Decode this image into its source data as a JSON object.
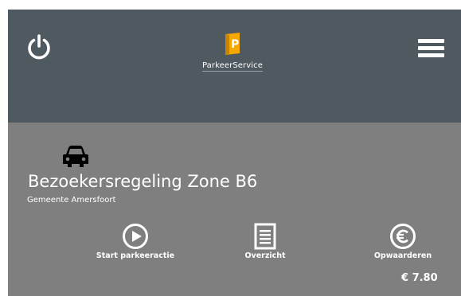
{
  "header": {
    "power_icon": "power-icon",
    "logo_text": "ParkeerService",
    "logo_color": "#f5a800",
    "menu_icon": "hamburger-menu-icon"
  },
  "zone": {
    "icon": "car-icon",
    "title": "Bezoekersregeling Zone B6",
    "municipality": "Gemeente Amersfoort"
  },
  "actions": [
    {
      "icon": "play-circle-icon",
      "label": "Start parkeeractie"
    },
    {
      "icon": "document-list-icon",
      "label": "Overzicht"
    },
    {
      "icon": "euro-circle-icon",
      "label": "Opwaarderen"
    }
  ],
  "balance": "€ 7.80",
  "colors": {
    "header_bg": "#4f5960",
    "card_bg": "#7f7f7f",
    "foreground": "#ffffff"
  }
}
